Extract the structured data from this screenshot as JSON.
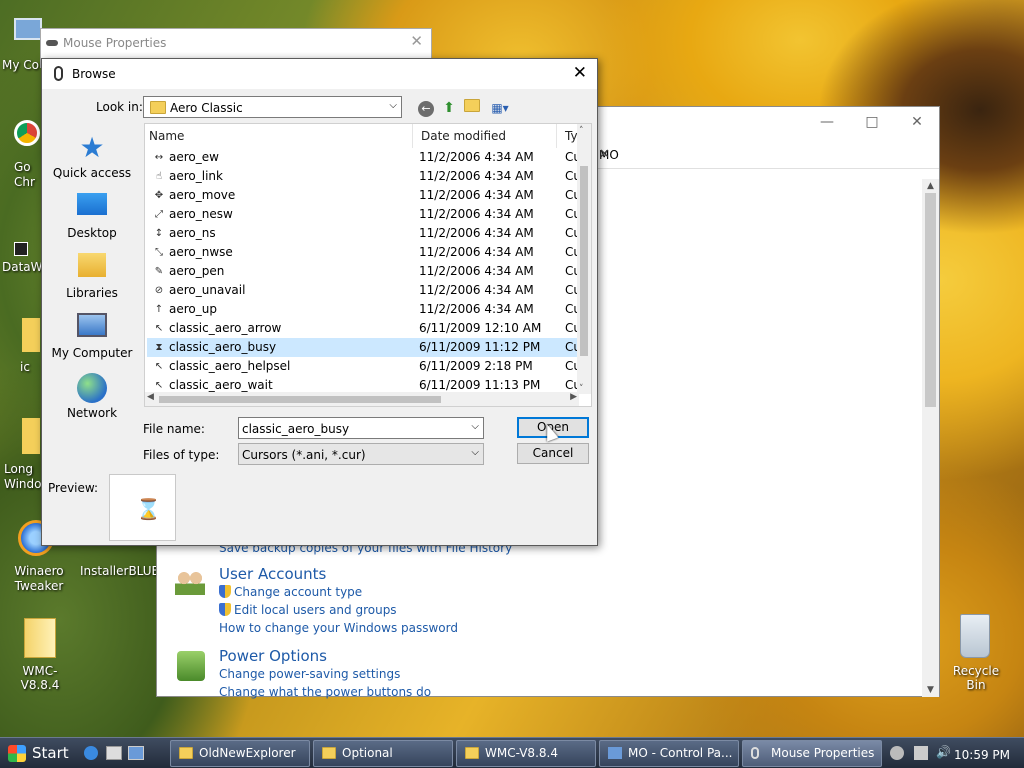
{
  "desktop": {
    "icons": [
      {
        "label": "My Co"
      },
      {
        "label": "Go\nChr"
      },
      {
        "label": "DataW"
      },
      {
        "label": "ic"
      },
      {
        "label": "Long\nWindo"
      },
      {
        "label": "Winaero\nTweaker"
      },
      {
        "label": "InstallerBLUE"
      },
      {
        "label": "WMC-V8.8.4"
      },
      {
        "label": "Recycle Bin"
      }
    ]
  },
  "control_panel": {
    "search_value": "MO",
    "partial_link": "Save backup copies of your files with File History",
    "sections": [
      {
        "heading": "User Accounts",
        "links": [
          "Change account type",
          "Edit local users and groups",
          "How to change your Windows password"
        ]
      },
      {
        "heading": "Power Options",
        "links": [
          "Change power-saving settings",
          "Change what the power buttons do"
        ]
      }
    ]
  },
  "mouse_properties": {
    "title": "Mouse Properties"
  },
  "browse": {
    "title": "Browse",
    "look_in_label": "Look in:",
    "look_in_value": "Aero Classic",
    "places": [
      "Quick access",
      "Desktop",
      "Libraries",
      "My Computer",
      "Network"
    ],
    "columns": {
      "name": "Name",
      "date": "Date modified",
      "type": "Ty"
    },
    "files": [
      {
        "name": "aero_ew",
        "date": "11/2/2006 4:34 AM",
        "type": "Cu",
        "icon": "↔"
      },
      {
        "name": "aero_link",
        "date": "11/2/2006 4:34 AM",
        "type": "Cu",
        "icon": "☝"
      },
      {
        "name": "aero_move",
        "date": "11/2/2006 4:34 AM",
        "type": "Cu",
        "icon": "✥"
      },
      {
        "name": "aero_nesw",
        "date": "11/2/2006 4:34 AM",
        "type": "Cu",
        "icon": "⤢"
      },
      {
        "name": "aero_ns",
        "date": "11/2/2006 4:34 AM",
        "type": "Cu",
        "icon": "↕"
      },
      {
        "name": "aero_nwse",
        "date": "11/2/2006 4:34 AM",
        "type": "Cu",
        "icon": "⤡"
      },
      {
        "name": "aero_pen",
        "date": "11/2/2006 4:34 AM",
        "type": "Cu",
        "icon": "✎"
      },
      {
        "name": "aero_unavail",
        "date": "11/2/2006 4:34 AM",
        "type": "Cu",
        "icon": "⊘"
      },
      {
        "name": "aero_up",
        "date": "11/2/2006 4:34 AM",
        "type": "Cu",
        "icon": "↑"
      },
      {
        "name": "classic_aero_arrow",
        "date": "6/11/2009 12:10 AM",
        "type": "Cu",
        "icon": "↖"
      },
      {
        "name": "classic_aero_busy",
        "date": "6/11/2009 11:12 PM",
        "type": "Cu",
        "icon": "⧗"
      },
      {
        "name": "classic_aero_helpsel",
        "date": "6/11/2009 2:18 PM",
        "type": "Cu",
        "icon": "↖"
      },
      {
        "name": "classic_aero_wait",
        "date": "6/11/2009 11:13 PM",
        "type": "Cu",
        "icon": "↖"
      }
    ],
    "selected_index": 10,
    "file_name_label": "File name:",
    "file_name_value": "classic_aero_busy",
    "files_of_type_label": "Files of type:",
    "files_of_type_value": "Cursors (*.ani, *.cur)",
    "open_label": "Open",
    "cancel_label": "Cancel",
    "preview_label": "Preview:"
  },
  "taskbar": {
    "start_label": "Start",
    "tasks": [
      "OldNewExplorer",
      "Optional",
      "WMC-V8.8.4",
      "MO - Control Pa...",
      "Mouse Properties"
    ],
    "active_task": 4,
    "clock": "10:59 PM"
  }
}
